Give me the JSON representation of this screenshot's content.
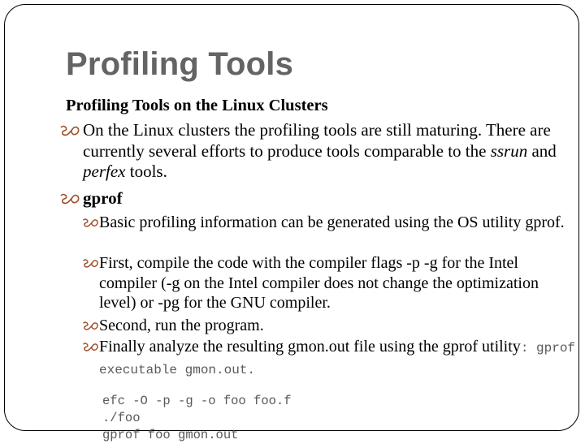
{
  "slide": {
    "title": "Profiling Tools",
    "subtitle": "Profiling Tools on the Linux Clusters",
    "bullet_color": "#a0522d",
    "title_color": "#646464",
    "intro": {
      "text_before": "On the Linux clusters the profiling tools are still maturing. There are currently several efforts to produce tools comparable to the ",
      "em1": "ssrun",
      "text_mid": " and ",
      "em2": "perfex",
      "text_after": " tools."
    },
    "gprof_heading": "gprof",
    "gprof_items": [
      {
        "text": "Basic profiling information can be generated using the OS utility gprof."
      },
      {
        "text": "First, compile the code with the compiler flags -p -g for the Intel compiler (-g on the Intel compiler does not change the optimization level) or -pg for the GNU compiler."
      },
      {
        "text": "Second, run the program."
      },
      {
        "text": "Finally analyze the resulting gmon.out file using the gprof utility",
        "code_suffix": ": gprof executable gmon.out."
      }
    ],
    "code_lines": [
      "efc -O -p -g -o foo foo.f",
      "./foo",
      "gprof foo gmon.out"
    ]
  }
}
